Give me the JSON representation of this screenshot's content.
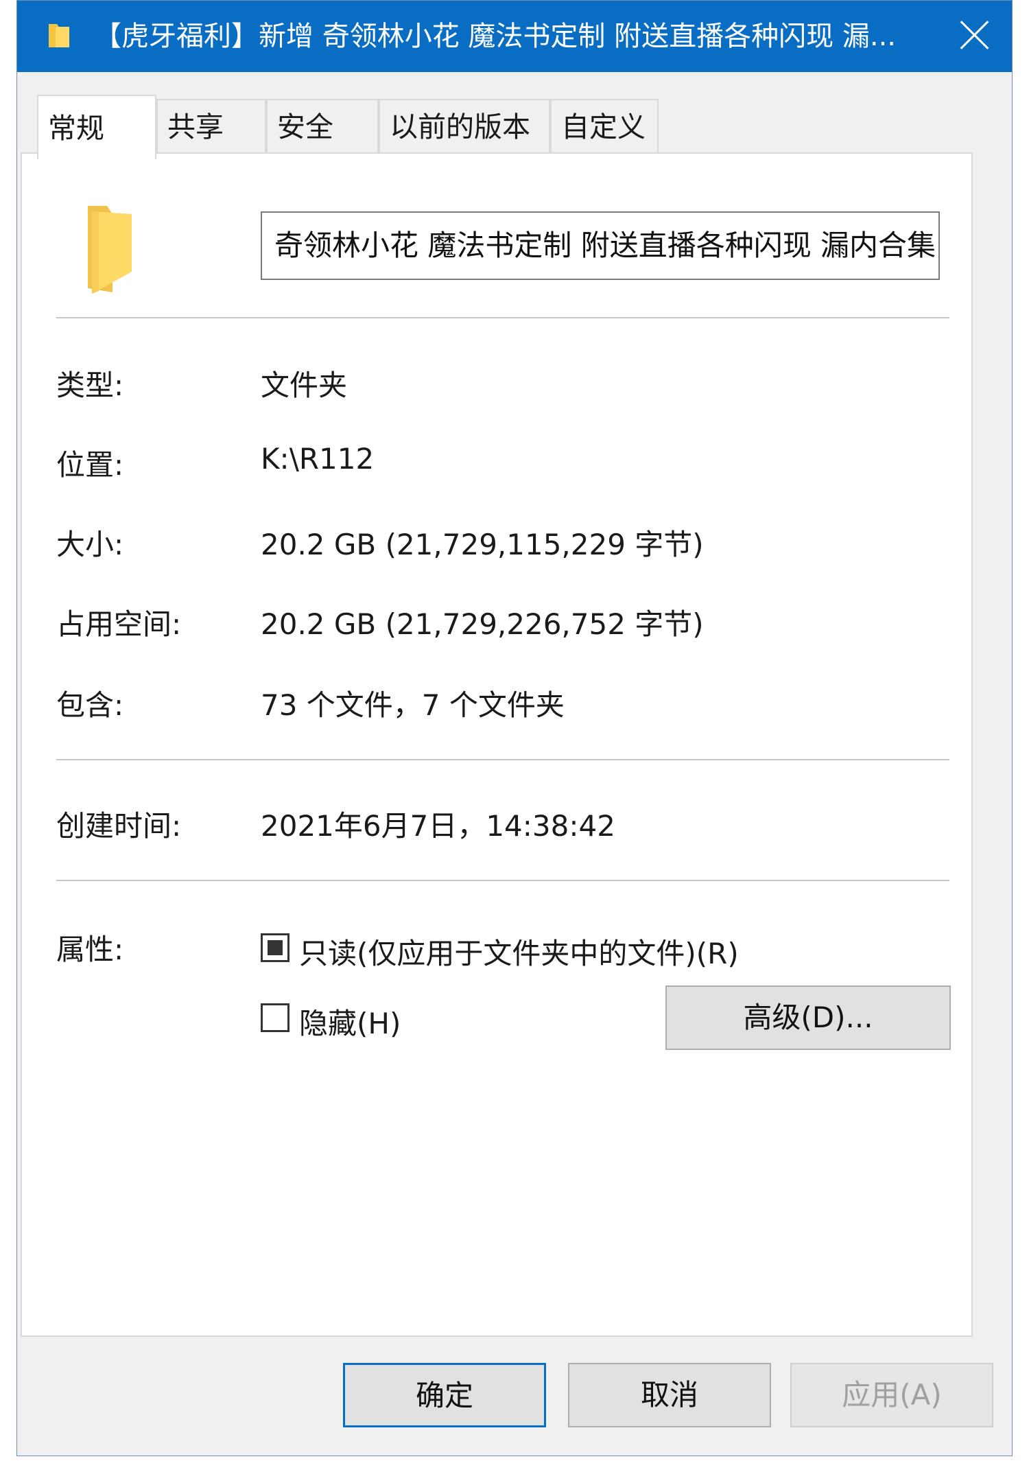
{
  "window": {
    "title": "【虎牙福利】新增 奇领林小花 魔法书定制 附送直播各种闪现 漏...",
    "accent_color": "#0a6dc4",
    "title_icon": "folder-icon",
    "close_icon": "close-icon"
  },
  "tabs": [
    {
      "label": "常规",
      "active": true
    },
    {
      "label": "共享",
      "active": false
    },
    {
      "label": "安全",
      "active": false
    },
    {
      "label": "以前的版本",
      "active": false
    },
    {
      "label": "自定义",
      "active": false
    }
  ],
  "general": {
    "folder_icon": "folder-icon",
    "name_value": "奇领林小花 魔法书定制 附送直播各种闪现 漏内合集",
    "rows": [
      {
        "label": "类型:",
        "value": "文件夹"
      },
      {
        "label": "位置:",
        "value": "K:\\R112"
      },
      {
        "label": "大小:",
        "value": "20.2 GB (21,729,115,229 字节)"
      },
      {
        "label": "占用空间:",
        "value": "20.2 GB (21,729,226,752 字节)"
      },
      {
        "label": "包含:",
        "value": "73 个文件，7 个文件夹"
      }
    ],
    "created": {
      "label": "创建时间:",
      "value": "2021年6月7日，14:38:42"
    },
    "attributes": {
      "label": "属性:",
      "readonly_label": "只读(仅应用于文件夹中的文件)(R)",
      "readonly_state": "indeterminate",
      "hidden_label": "隐藏(H)",
      "hidden_state": "unchecked",
      "advanced_button": "高级(D)..."
    }
  },
  "footer": {
    "ok": "确定",
    "cancel": "取消",
    "apply": "应用(A)"
  }
}
